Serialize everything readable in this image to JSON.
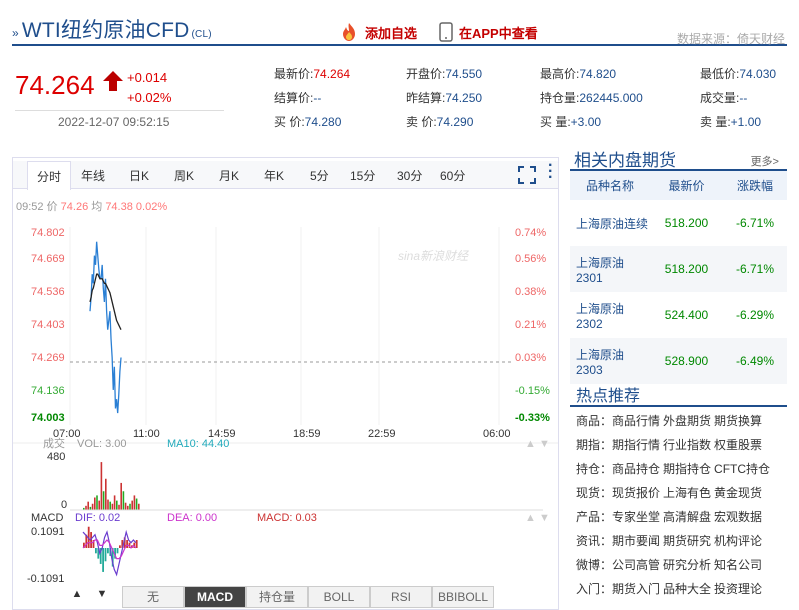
{
  "header": {
    "title": "WTI纽约原油CFD",
    "title_sub": "(CL)",
    "add_fav": "添加自选",
    "app_view": "在APP中查看",
    "source": "数据来源：倚天财经"
  },
  "quote": {
    "price": "74.264",
    "change": "+0.014",
    "change_pct": "+0.02%",
    "datetime": "2022-12-07 09:52:15"
  },
  "stats": [
    {
      "label": "最新价:",
      "value": "74.264",
      "color": "red"
    },
    {
      "label": "开盘价:",
      "value": "74.550",
      "color": "blue"
    },
    {
      "label": "最高价:",
      "value": "74.820",
      "color": "blue"
    },
    {
      "label": "最低价:",
      "value": "74.030",
      "color": "blue"
    },
    {
      "label": "结算价:",
      "value": "--",
      "color": "blue"
    },
    {
      "label": "昨结算:",
      "value": "74.250",
      "color": "blue"
    },
    {
      "label": "持仓量:",
      "value": "262445.000",
      "color": "blue"
    },
    {
      "label": "成交量:",
      "value": "--",
      "color": "blue"
    },
    {
      "label": "买  价:",
      "value": "74.280",
      "color": "blue"
    },
    {
      "label": "卖  价:",
      "value": "74.290",
      "color": "blue"
    },
    {
      "label": "买  量:",
      "value": "+3.00",
      "color": "blue"
    },
    {
      "label": "卖  量:",
      "value": "+1.00",
      "color": "blue"
    }
  ],
  "tabs": [
    "分时",
    "年线",
    "日K",
    "周K",
    "月K",
    "年K",
    "5分",
    "15分",
    "30分",
    "60分"
  ],
  "chart_info": {
    "time": "09:52",
    "price_label": "价",
    "price": "74.26",
    "avg_label": "均",
    "avg": "74.38",
    "pct": "0.02%"
  },
  "chart_data": {
    "type": "line",
    "y_ticks": [
      "74.802",
      "74.669",
      "74.536",
      "74.403",
      "74.269",
      "74.136",
      "74.003"
    ],
    "pct_ticks": [
      "0.74%",
      "0.56%",
      "0.38%",
      "0.21%",
      "0.03%",
      "-0.15%",
      "-0.33%"
    ],
    "x_ticks": [
      "07:00",
      "11:00",
      "14:59",
      "18:59",
      "22:59",
      "06:00"
    ],
    "ylim": [
      74.003,
      74.802
    ],
    "series": [
      {
        "values": [
          74.46,
          74.52,
          74.62,
          74.58,
          74.7,
          74.66,
          74.76,
          74.7,
          74.64,
          74.6,
          74.6,
          74.66,
          74.56,
          74.5,
          74.6,
          74.46,
          74.38,
          74.42,
          74.46,
          74.34,
          74.26,
          74.12,
          74.22,
          74.04,
          74.08,
          74.02,
          74.1,
          74.2,
          74.26
        ]
      },
      {
        "values": [
          74.5,
          74.52,
          74.55,
          74.56,
          74.58,
          74.6,
          74.62,
          74.62,
          74.61,
          74.6,
          74.6,
          74.6,
          74.59,
          74.58,
          74.58,
          74.57,
          74.56,
          74.55,
          74.54,
          74.52,
          74.5,
          74.48,
          74.46,
          74.44,
          74.42,
          74.41,
          74.4,
          74.39,
          74.38
        ]
      }
    ],
    "watermark": "sina新浪财经"
  },
  "volume": {
    "label": "成交",
    "vol_label": "VOL: 3.00",
    "ma_label": "MA10: 44.40",
    "max": "480",
    "min": "0",
    "values": [
      20,
      40,
      80,
      30,
      60,
      120,
      140,
      90,
      460,
      180,
      300,
      100,
      80,
      60,
      140,
      90,
      50,
      260,
      180,
      70,
      40,
      60,
      90,
      140,
      110,
      60
    ]
  },
  "macd": {
    "label": "MACD",
    "dif": "DIF: 0.02",
    "dea": "DEA: 0.00",
    "macd": "MACD: 0.03",
    "max": "0.1091",
    "min": "-0.1091",
    "bars": [
      0.02,
      0.05,
      0.08,
      0.06,
      0.03,
      -0.02,
      -0.04,
      -0.06,
      -0.09,
      -0.05,
      -0.02,
      -0.03,
      -0.07,
      -0.04,
      -0.02,
      0.01,
      0.03,
      0.04,
      0.03,
      0.02,
      0.01,
      0.02,
      0.03
    ],
    "dif_vals": [
      0.06,
      0.05,
      0.04,
      0.03,
      0.04,
      0.05,
      0.02,
      -0.02,
      0.0,
      0.04,
      0.06,
      0.02,
      -0.04,
      -0.08,
      -0.1,
      -0.06,
      -0.02,
      0.02,
      0.06,
      0.03,
      0.02,
      0.03,
      0.02
    ],
    "dea_vals": [
      0.0,
      0.01,
      0.02,
      0.02,
      0.02,
      0.03,
      0.03,
      0.01,
      0.01,
      0.02,
      0.03,
      0.02,
      0.0,
      -0.02,
      -0.04,
      -0.04,
      -0.03,
      -0.01,
      0.01,
      0.01,
      0.0,
      0.01,
      0.0
    ]
  },
  "bottom_tabs": [
    "无",
    "MACD",
    "持仓量",
    "BOLL",
    "RSI",
    "BBIBOLL"
  ],
  "right": {
    "title": "相关内盘期货",
    "more": "更多>",
    "cols": [
      "品种名称",
      "最新价",
      "涨跌幅"
    ],
    "rows": [
      {
        "name": "上海原油连续",
        "price": "518.200",
        "pct": "-6.71%"
      },
      {
        "name": "上海原油2301",
        "price": "518.200",
        "pct": "-6.71%"
      },
      {
        "name": "上海原油2302",
        "price": "524.400",
        "pct": "-6.29%"
      },
      {
        "name": "上海原油2303",
        "price": "528.900",
        "pct": "-6.49%"
      }
    ],
    "hot_title": "热点推荐",
    "hot": [
      {
        "k": "商品：",
        "links": [
          "商品行情",
          "外盘期货",
          "期货换算"
        ]
      },
      {
        "k": "期指：",
        "links": [
          "期指行情",
          "行业指数",
          "权重股票"
        ]
      },
      {
        "k": "持仓：",
        "links": [
          "商品持仓",
          "期指持仓",
          "CFTC持仓"
        ]
      },
      {
        "k": "现货：",
        "links": [
          "现货报价",
          "上海有色",
          "黄金现货"
        ]
      },
      {
        "k": "产品：",
        "links": [
          "专家坐堂",
          "高清解盘",
          "宏观数据"
        ]
      },
      {
        "k": "资讯：",
        "links": [
          "期市要闻",
          "期货研究",
          "机构评论"
        ]
      },
      {
        "k": "微博：",
        "links": [
          "公司高管",
          "研究分析",
          "知名公司"
        ]
      },
      {
        "k": "入门：",
        "links": [
          "期货入门",
          "品种大全",
          "投资理论"
        ]
      }
    ]
  }
}
